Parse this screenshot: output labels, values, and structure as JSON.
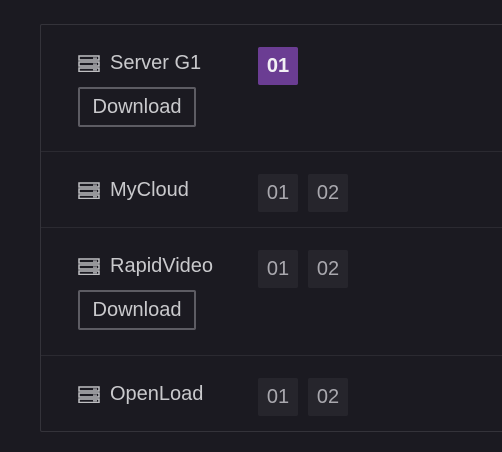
{
  "servers": [
    {
      "name": "Server G1",
      "download_label": "Download",
      "episodes": [
        "01"
      ],
      "active_episode": "01"
    },
    {
      "name": "MyCloud",
      "episodes": [
        "01",
        "02"
      ]
    },
    {
      "name": "RapidVideo",
      "download_label": "Download",
      "episodes": [
        "01",
        "02"
      ]
    },
    {
      "name": "OpenLoad",
      "episodes": [
        "01",
        "02"
      ]
    }
  ],
  "colors": {
    "background": "#1b1a21",
    "active_episode": "#6b3d93",
    "episode_tile": "#26252c",
    "text": "#c9c9cc"
  },
  "icons": {
    "server": "server-stack-icon"
  }
}
